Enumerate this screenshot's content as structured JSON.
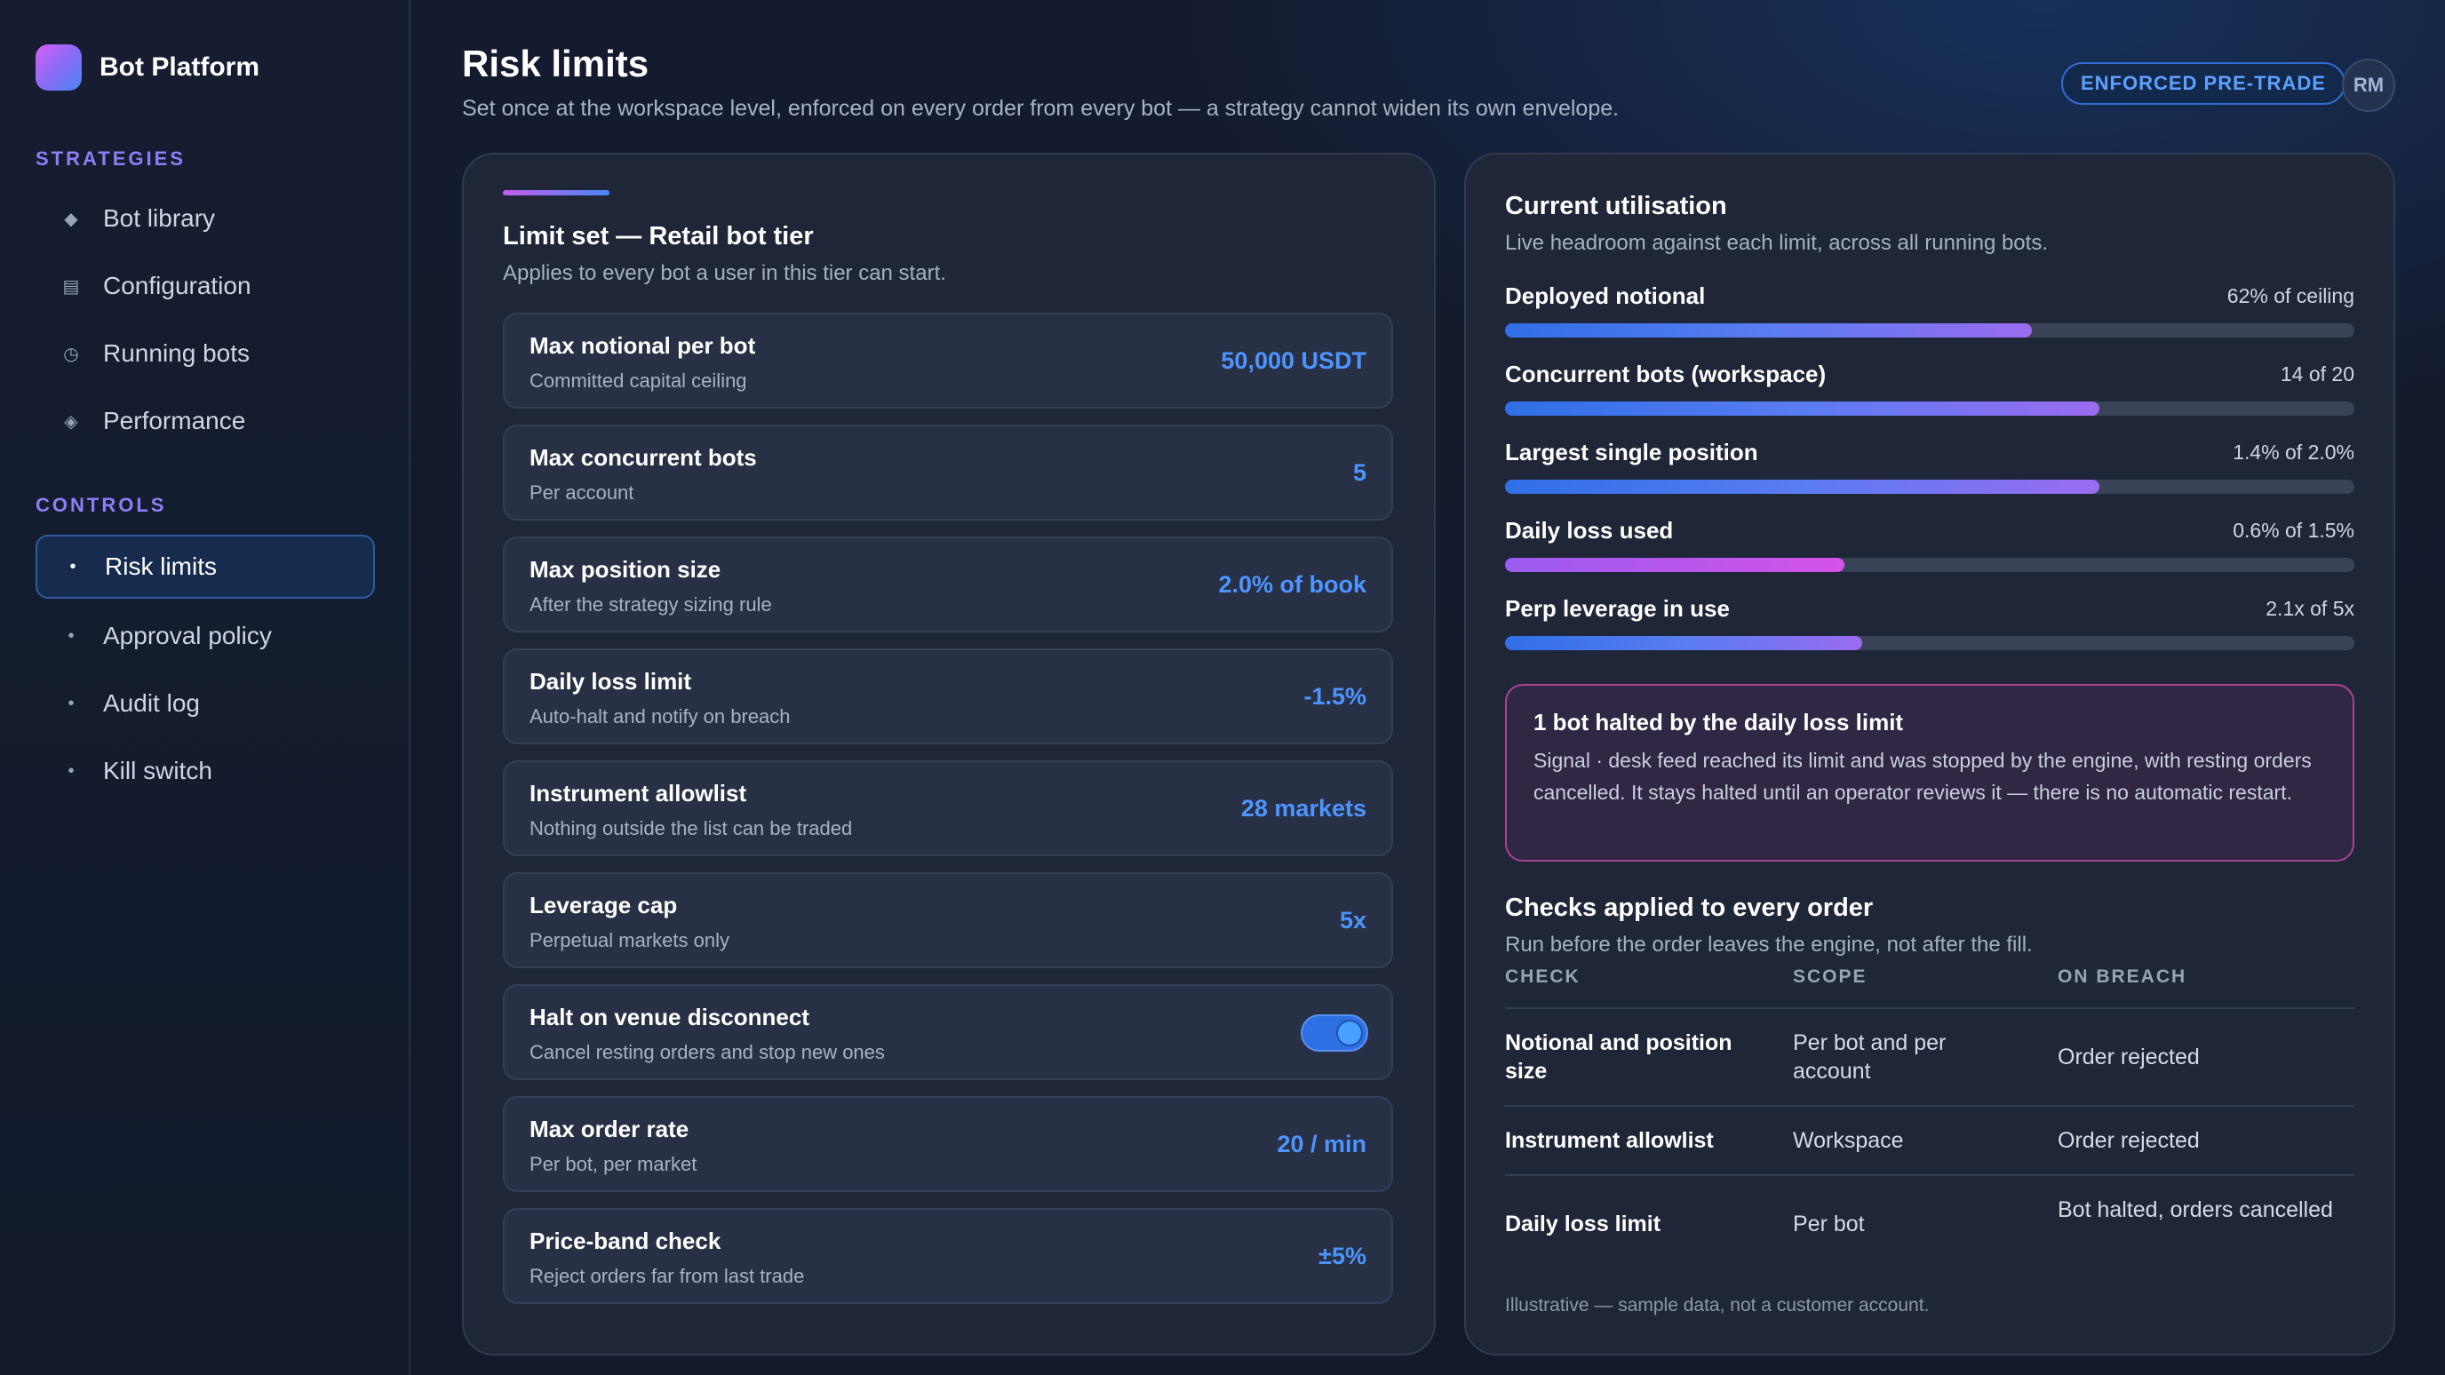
{
  "brand": {
    "name": "Bot Platform"
  },
  "sidebar": {
    "sections": [
      {
        "title": "STRATEGIES",
        "items": [
          {
            "label": "Bot library",
            "icon": "diamond-icon"
          },
          {
            "label": "Configuration",
            "icon": "list-icon"
          },
          {
            "label": "Running bots",
            "icon": "clock-icon"
          },
          {
            "label": "Performance",
            "icon": "diamond-outline-icon"
          }
        ]
      },
      {
        "title": "CONTROLS",
        "items": [
          {
            "label": "Risk limits",
            "icon": "dot-icon",
            "active": true
          },
          {
            "label": "Approval policy",
            "icon": "dot-icon"
          },
          {
            "label": "Audit log",
            "icon": "dot-icon"
          },
          {
            "label": "Kill switch",
            "icon": "dot-icon"
          }
        ]
      }
    ]
  },
  "header": {
    "title": "Risk limits",
    "subtitle": "Set once at the workspace level, enforced on every order from every bot — a strategy cannot widen its own envelope.",
    "badge": "ENFORCED PRE-TRADE",
    "avatar": "RM"
  },
  "limit_set": {
    "title": "Limit set — Retail bot tier",
    "subtitle": "Applies to every bot a user in this tier can start.",
    "rows": [
      {
        "name": "Max notional per bot",
        "desc": "Committed capital ceiling",
        "value": "50,000 USDT"
      },
      {
        "name": "Max concurrent bots",
        "desc": "Per account",
        "value": "5"
      },
      {
        "name": "Max position size",
        "desc": "After the strategy sizing rule",
        "value": "2.0% of book"
      },
      {
        "name": "Daily loss limit",
        "desc": "Auto-halt and notify on breach",
        "value": "-1.5%"
      },
      {
        "name": "Instrument allowlist",
        "desc": "Nothing outside the list can be traded",
        "value": "28 markets"
      },
      {
        "name": "Leverage cap",
        "desc": "Perpetual markets only",
        "value": "5x"
      },
      {
        "name": "Halt on venue disconnect",
        "desc": "Cancel resting orders and stop new ones",
        "toggle": true
      },
      {
        "name": "Max order rate",
        "desc": "Per bot, per market",
        "value": "20 / min"
      },
      {
        "name": "Price-band check",
        "desc": "Reject orders far from last trade",
        "value": "±5%"
      }
    ]
  },
  "utilisation": {
    "title": "Current utilisation",
    "subtitle": "Live headroom against each limit, across all running bots.",
    "items": [
      {
        "name": "Deployed notional",
        "value": "62% of ceiling",
        "fraction": 0.62,
        "color": "blue-violet"
      },
      {
        "name": "Concurrent bots (workspace)",
        "value": "14 of 20",
        "fraction": 0.7,
        "color": "blue-violet"
      },
      {
        "name": "Largest single position",
        "value": "1.4% of 2.0%",
        "fraction": 0.7,
        "color": "blue-violet"
      },
      {
        "name": "Daily loss used",
        "value": "0.6% of 1.5%",
        "fraction": 0.4,
        "color": "magenta"
      },
      {
        "name": "Perp leverage in use",
        "value": "2.1x of 5x",
        "fraction": 0.42,
        "color": "blue-violet"
      }
    ]
  },
  "alert": {
    "title": "1 bot halted by the daily loss limit",
    "body": "Signal · desk feed reached its limit and was stopped by the engine, with resting orders cancelled. It stays halted until an operator reviews it — there is no automatic restart."
  },
  "checks": {
    "title": "Checks applied to every order",
    "subtitle": "Run before the order leaves the engine, not after the fill.",
    "headers": [
      "CHECK",
      "SCOPE",
      "ON BREACH"
    ],
    "rows": [
      [
        "Notional and position size",
        "Per bot and per account",
        "Order rejected"
      ],
      [
        "Instrument allowlist",
        "Workspace",
        "Order rejected"
      ],
      [
        "Daily loss limit",
        "Per bot",
        "Bot halted, orders cancelled"
      ]
    ]
  },
  "footnote": "Illustrative — sample data, not a customer account.",
  "colors": {
    "accent_blue": "#4d94ff",
    "accent_violet": "#8c7ef5",
    "alert_border": "#a9438f"
  }
}
